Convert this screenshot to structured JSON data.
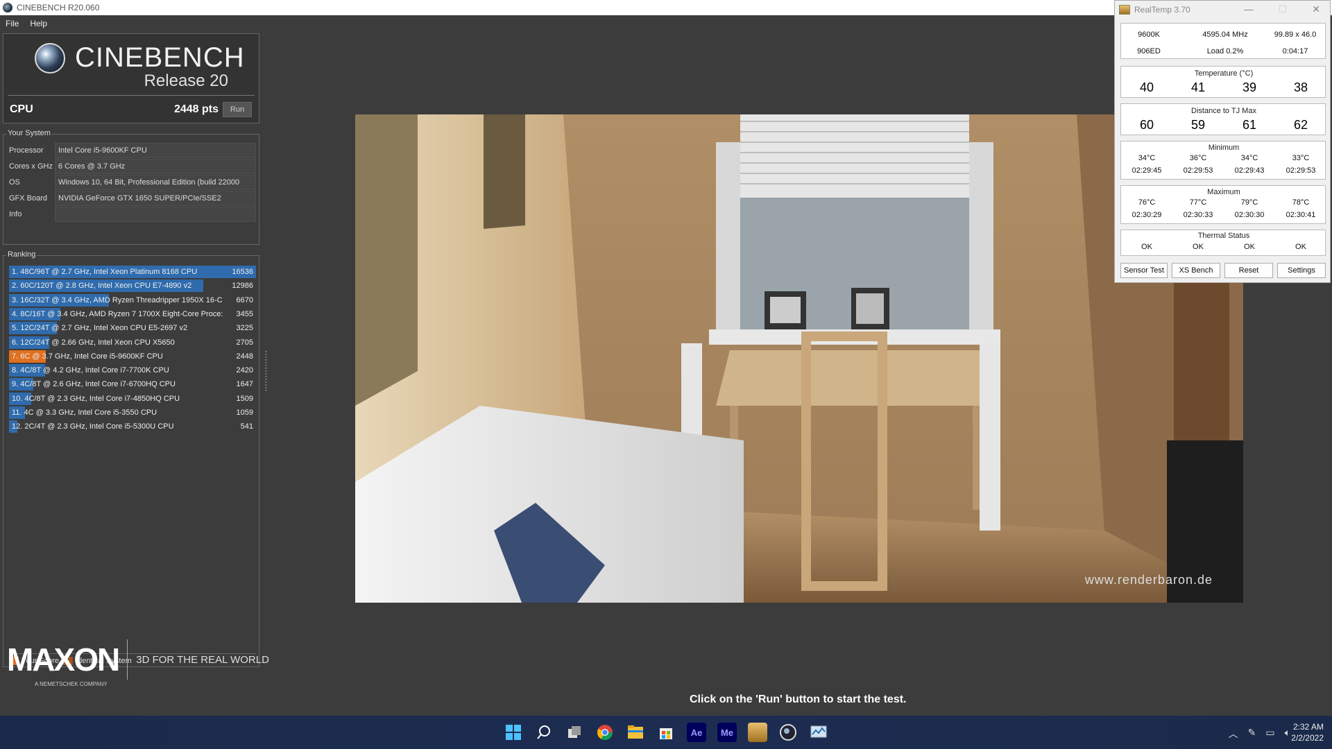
{
  "window": {
    "title": "CINEBENCH R20.060"
  },
  "menu": {
    "file": "File",
    "help": "Help"
  },
  "logo": {
    "name": "CINEBENCH",
    "release": "Release 20"
  },
  "cpu": {
    "label": "CPU",
    "score": "2448 pts",
    "run": "Run"
  },
  "system": {
    "title": "Your System",
    "rows": [
      {
        "key": "Processor",
        "value": "Intel Core i5-9600KF CPU"
      },
      {
        "key": "Cores x GHz",
        "value": "6 Cores @ 3.7 GHz"
      },
      {
        "key": "OS",
        "value": "Windows 10, 64 Bit, Professional Edition (build 22000"
      },
      {
        "key": "GFX Board",
        "value": "NVIDIA GeForce GTX 1650 SUPER/PCIe/SSE2"
      },
      {
        "key": "Info",
        "value": ""
      }
    ]
  },
  "ranking": {
    "title": "Ranking",
    "items": [
      {
        "text": "1. 48C/96T @ 2.7 GHz, Intel Xeon Platinum 8168 CPU",
        "score": "16536",
        "value": 16536,
        "color": "#2f6bad"
      },
      {
        "text": "2. 60C/120T @ 2.8 GHz, Intel Xeon CPU E7-4890 v2",
        "score": "12986",
        "value": 12986,
        "color": "#2f6bad"
      },
      {
        "text": "3. 16C/32T @ 3.4 GHz, AMD Ryzen Threadripper 1950X 16-C",
        "score": "6670",
        "value": 6670,
        "color": "#2f6bad"
      },
      {
        "text": "4. 8C/16T @ 3.4 GHz, AMD Ryzen 7 1700X Eight-Core Proce:",
        "score": "3455",
        "value": 3455,
        "color": "#2f6bad"
      },
      {
        "text": "5. 12C/24T @ 2.7 GHz, Intel Xeon CPU E5-2697 v2",
        "score": "3225",
        "value": 3225,
        "color": "#2f6bad"
      },
      {
        "text": "6. 12C/24T @ 2.66 GHz, Intel Xeon CPU X5650",
        "score": "2705",
        "value": 2705,
        "color": "#2f6bad"
      },
      {
        "text": "7. 6C @ 3.7 GHz, Intel Core i5-9600KF CPU",
        "score": "2448",
        "value": 2448,
        "color": "#e07020"
      },
      {
        "text": "8. 4C/8T @ 4.2 GHz, Intel Core i7-7700K CPU",
        "score": "2420",
        "value": 2420,
        "color": "#2f6bad"
      },
      {
        "text": "9. 4C/8T @ 2.6 GHz, Intel Core i7-6700HQ CPU",
        "score": "1647",
        "value": 1647,
        "color": "#2f6bad"
      },
      {
        "text": "10. 4C/8T @ 2.3 GHz, Intel Core i7-4850HQ CPU",
        "score": "1509",
        "value": 1509,
        "color": "#2f6bad"
      },
      {
        "text": "11. 4C @ 3.3 GHz, Intel Core i5-3550 CPU",
        "score": "1059",
        "value": 1059,
        "color": "#2f6bad"
      },
      {
        "text": "12. 2C/4T @ 2.3 GHz, Intel Core i5-5300U CPU",
        "score": "541",
        "value": 541,
        "color": "#2f6bad"
      }
    ],
    "legend": {
      "your_score": "Your Score",
      "identical": "Identical System",
      "your_color": "#e07020",
      "identical_color": "#a0521d"
    }
  },
  "maxon": {
    "word": "MAXON",
    "small": "A NEMETSCHEK COMPANY",
    "tagline": "3D FOR THE REAL WORLD"
  },
  "render": {
    "watermark": "www.renderbaron.de"
  },
  "status": {
    "message": "Click on the 'Run' button to start the test."
  },
  "realtemp": {
    "title": "RealTemp 3.70",
    "cpu": "9600K",
    "freq": "4595.04 MHz",
    "multi": "99.89 x 46.0",
    "id": "906ED",
    "load": "Load  0.2%",
    "time": "0:04:17",
    "temp_caption": "Temperature (°C)",
    "temps": [
      "40",
      "41",
      "39",
      "38"
    ],
    "tj_caption": "Distance to TJ Max",
    "tj": [
      "60",
      "59",
      "61",
      "62"
    ],
    "min_caption": "Minimum",
    "min_temps": [
      "34°C",
      "36°C",
      "34°C",
      "33°C"
    ],
    "min_times": [
      "02:29:45",
      "02:29:53",
      "02:29:43",
      "02:29:53"
    ],
    "max_caption": "Maximum",
    "max_temps": [
      "76°C",
      "77°C",
      "79°C",
      "78°C"
    ],
    "max_times": [
      "02:30:29",
      "02:30:33",
      "02:30:30",
      "02:30:41"
    ],
    "thermal_caption": "Thermal Status",
    "thermal": [
      "OK",
      "OK",
      "OK",
      "OK"
    ],
    "buttons": {
      "sensor": "Sensor Test",
      "xs": "XS Bench",
      "reset": "Reset",
      "settings": "Settings"
    }
  },
  "taskbar": {
    "icons": [
      "windows-start-icon",
      "search-icon",
      "task-view-icon",
      "chrome-icon",
      "file-explorer-icon",
      "store-icon",
      "after-effects-icon",
      "media-encoder-icon",
      "realtemp-icon",
      "cinebench-icon",
      "monitor-app-icon"
    ],
    "ae": "Ae",
    "me": "Me",
    "time": "2:32 AM",
    "date": "2/2/2022"
  }
}
